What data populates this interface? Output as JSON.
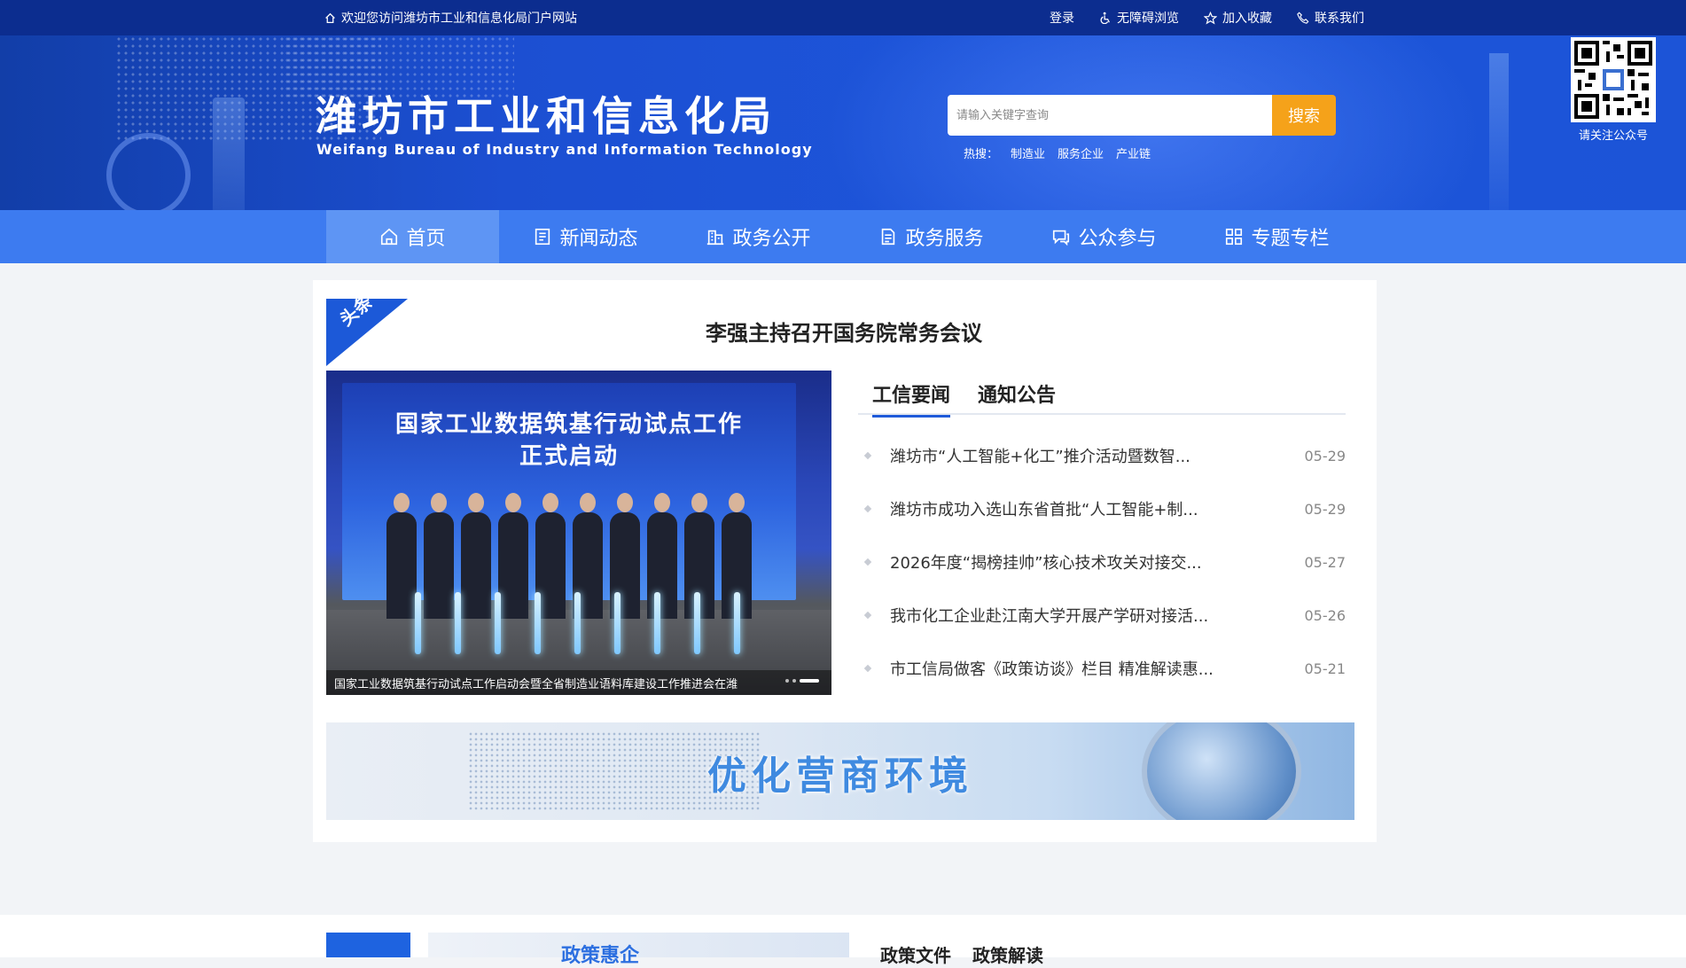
{
  "topbar": {
    "welcome": "欢迎您访问潍坊市工业和信息化局门户网站",
    "login": "登录",
    "accessible": "无障碍浏览",
    "favorite": "加入收藏",
    "contact": "联系我们"
  },
  "header": {
    "title_cn": "潍坊市工业和信息化局",
    "title_en": "Weifang Bureau of Industry and Information Technology",
    "search_placeholder": "请输入关键字查询",
    "search_button": "搜索",
    "hot_label": "热搜：",
    "hot_words": [
      "制造业",
      "服务企业",
      "产业链"
    ],
    "qr_caption": "请关注公众号"
  },
  "nav": {
    "items": [
      {
        "label": "首页",
        "icon": "home-icon"
      },
      {
        "label": "新闻动态",
        "icon": "news-icon"
      },
      {
        "label": "政务公开",
        "icon": "building-icon"
      },
      {
        "label": "政务服务",
        "icon": "document-icon"
      },
      {
        "label": "公众参与",
        "icon": "chat-icon"
      },
      {
        "label": "专题专栏",
        "icon": "grid-icon"
      }
    ],
    "active": "首页"
  },
  "main": {
    "ribbon": "头条",
    "headline": "李强主持召开国务院常务会议",
    "carousel": {
      "board_line1": "国家工业数据筑基行动试点工作",
      "board_line2": "正式启动",
      "caption": "国家工业数据筑基行动试点工作启动会暨全省制造业语料库建设工作推进会在潍"
    },
    "tabs": [
      "工信要闻",
      "通知公告"
    ],
    "active_tab": "工信要闻",
    "news": [
      {
        "title": "潍坊市“人工智能+化工”推介活动暨数智...",
        "date": "05-29"
      },
      {
        "title": "潍坊市成功入选山东省首批“人工智能+制...",
        "date": "05-29"
      },
      {
        "title": "2026年度“揭榜挂帅”核心技术攻关对接交...",
        "date": "05-27"
      },
      {
        "title": "我市化工企业赴江南大学开展产学研对接活...",
        "date": "05-26"
      },
      {
        "title": "市工信局做客《政策访谈》栏目 精准解读惠...",
        "date": "05-21"
      }
    ],
    "ad_banner": "优化营商环境"
  },
  "section2": {
    "banner_text": "政策惠企",
    "tabs": [
      "政策文件",
      "政策解读"
    ]
  },
  "colors": {
    "topbar": "#0c2d8f",
    "nav": "#3d7bf0",
    "nav_active": "#5e95f4",
    "search_button": "#f5a21a",
    "accent": "#1e5ad9"
  }
}
